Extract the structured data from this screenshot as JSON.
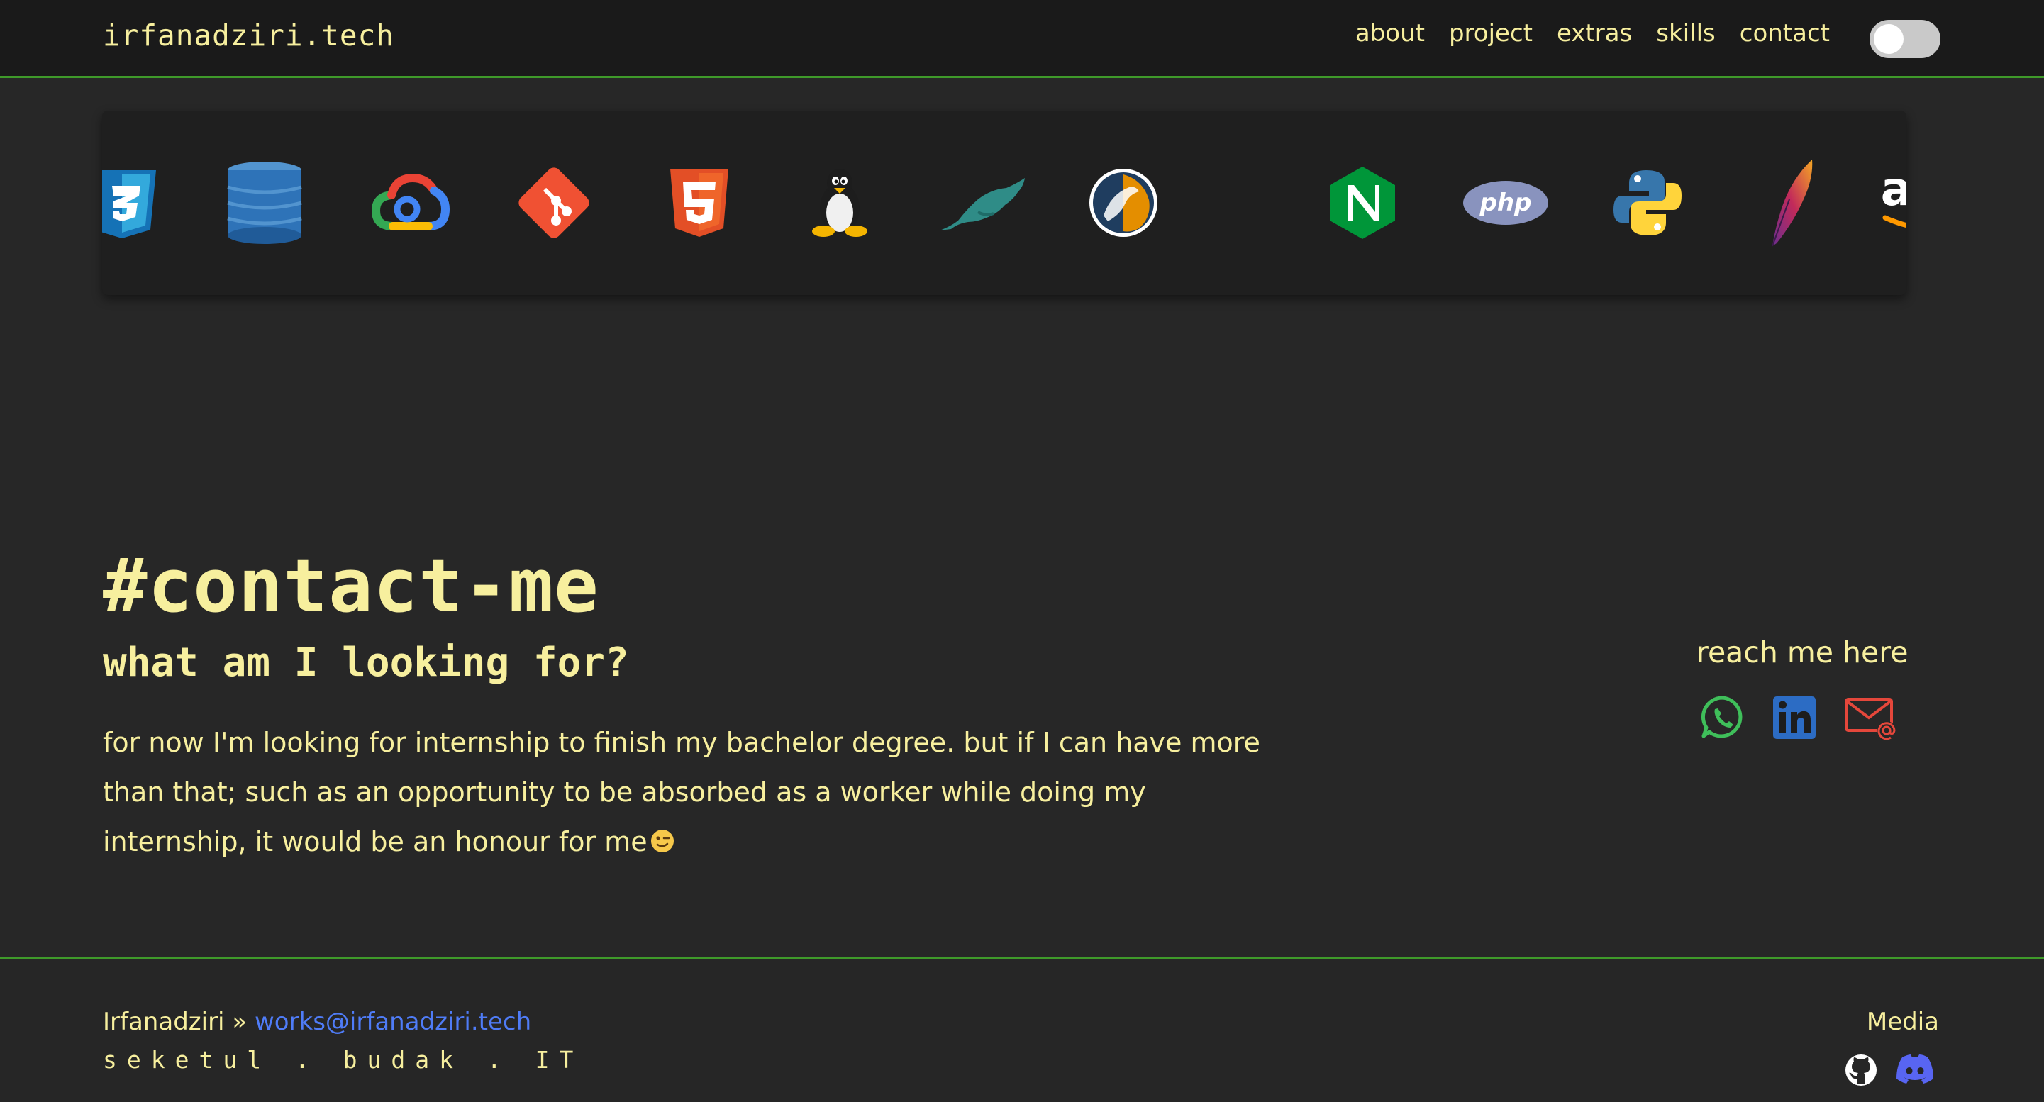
{
  "header": {
    "brand": "irfanadziri.tech",
    "nav": [
      "about",
      "project",
      "extras",
      "skills",
      "contact"
    ],
    "theme_toggle": "dark-mode-toggle"
  },
  "skills_strip": {
    "icons": [
      "css3-icon",
      "aws-dynamodb-icon",
      "google-cloud-icon",
      "git-icon",
      "html5-icon",
      "linux-tux-icon",
      "mariadb-icon",
      "mysql-icon",
      "nginx-icon",
      "php-icon",
      "python-icon",
      "apache-icon",
      "aws-icon"
    ],
    "aws_text": "aws",
    "php_text": "php"
  },
  "contact": {
    "title": "#contact-me",
    "subtitle": "what am I looking for?",
    "paragraph": "for now I'm looking for internship to finish my bachelor degree. but if I can have more than that; such as an opportunity to be absorbed as a worker while doing my internship, it would be an honour for me",
    "reach_label": "reach me here",
    "reach_icons": [
      "whatsapp-icon",
      "linkedin-icon",
      "email-icon"
    ]
  },
  "footer": {
    "name": "Irfanadziri",
    "separator": "»",
    "email": "works@irfanadziri.tech",
    "tagline": "seketul . budak . IT",
    "media_label": "Media",
    "media_icons": [
      "github-icon",
      "discord-icon"
    ]
  },
  "colors": {
    "background": "#272727",
    "header_bg": "#1a1a1a",
    "accent_text": "#f7ef9e",
    "divider_green": "#3f9a2a",
    "link_blue": "#4f7cf7"
  }
}
